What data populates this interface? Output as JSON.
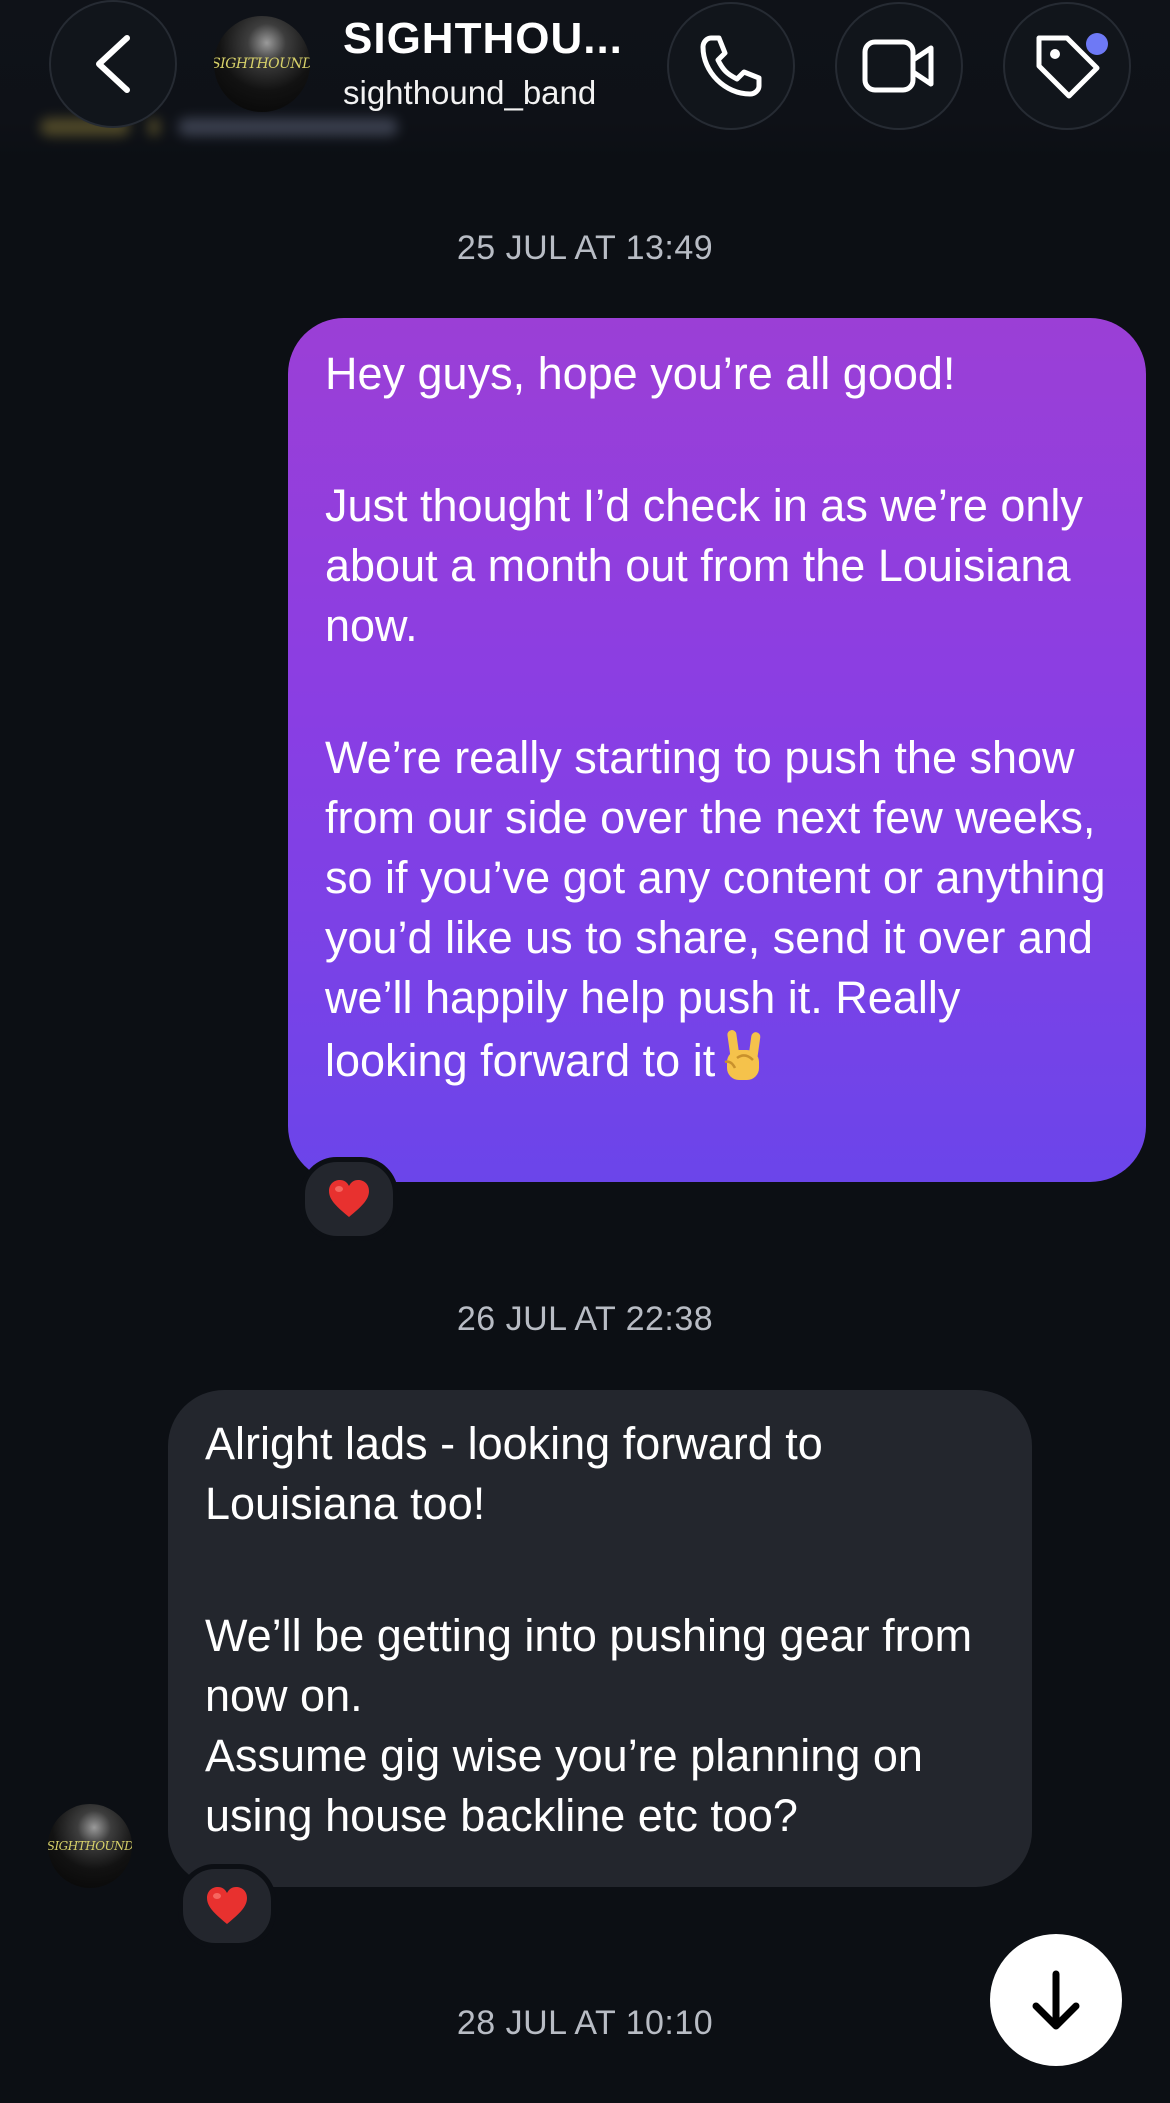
{
  "header": {
    "contact_name": "SIGHTHOU...",
    "contact_handle": "sighthound_band",
    "avatar_text": "SIGHTHOUND",
    "icons": {
      "back": "chevron-left-icon",
      "call": "phone-icon",
      "video": "video-camera-icon",
      "tag": "tag-icon"
    },
    "tag_dot_color": "#6e79f5"
  },
  "messages": [
    {
      "timestamp": "25 JUL AT 13:49",
      "direction": "outgoing",
      "paragraphs": [
        "Hey guys, hope you’re all good!",
        "Just thought I’d check in as we’re only about a month out from the Louisiana now.",
        "We’re really starting to push the show from our side over the next few weeks, so if you’ve got any content or anything you’d like us to share, send it over and we’ll happily help push it. Really looking forward to it"
      ],
      "trailing_emoji": "rock-on-hand-emoji",
      "reaction": "red-heart-emoji",
      "bubble_color_top": "#9b3fd6",
      "bubble_color_bottom": "#6b45ea"
    },
    {
      "timestamp": "26 JUL AT 22:38",
      "direction": "incoming",
      "paragraphs": [
        "Alright lads - looking forward to Louisiana too!",
        "We’ll be getting into pushing gear from now on.\nAssume gig wise you’re planning on using house backline etc too?"
      ],
      "reaction": "red-heart-emoji",
      "sender_avatar_text": "SIGHTHOUND",
      "bubble_color": "#23262d"
    }
  ],
  "next_timestamp": "28 JUL AT 10:10",
  "scroll_button_icon": "arrow-down-icon"
}
